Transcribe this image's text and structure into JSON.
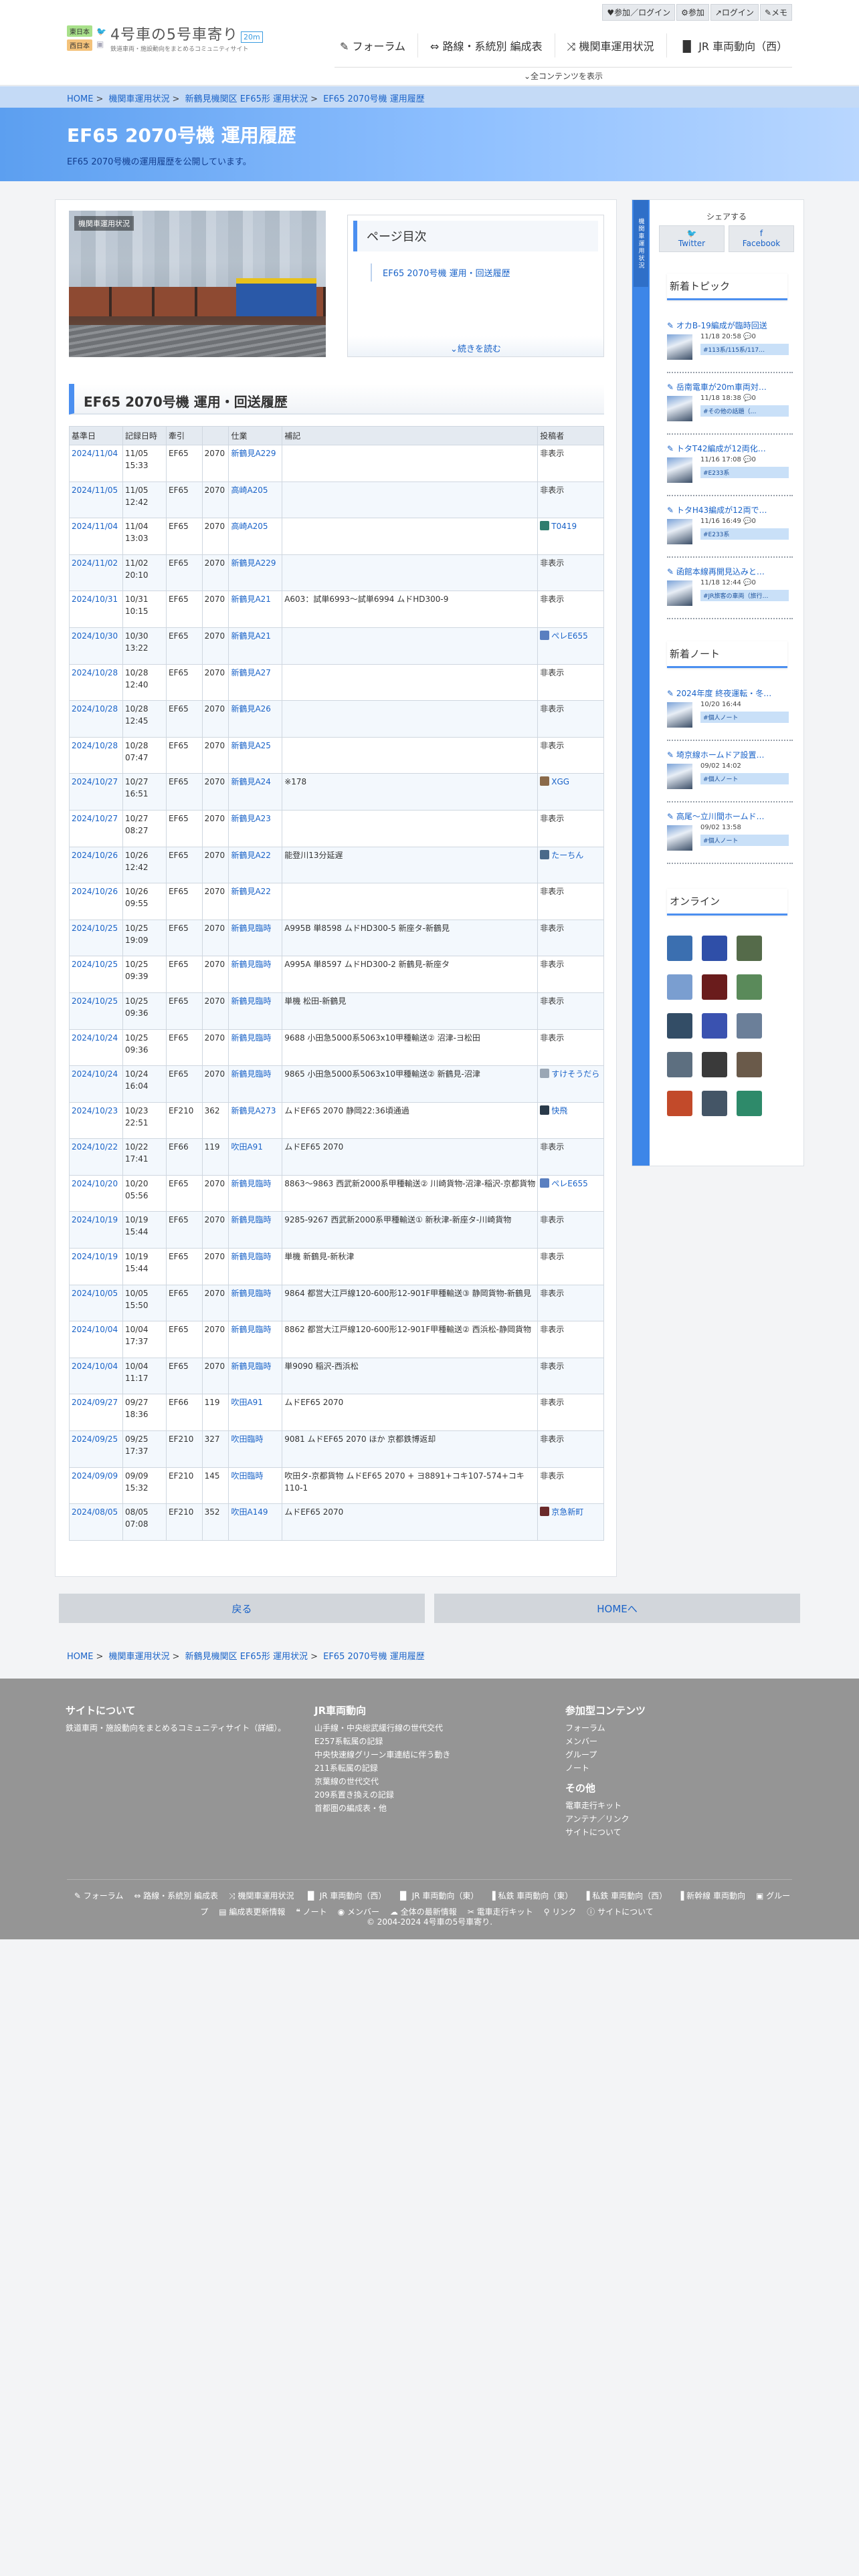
{
  "header": {
    "user_links": [
      "♥参加／ログイン",
      "⚙参加",
      "↗ログイン",
      "✎メモ"
    ],
    "tag_east": "東日本",
    "tag_west": "西日本",
    "site_title": "4号車の5号車寄り",
    "site_subtitle": "鉄道車両・施設動向をまとめるコミュニティサイト",
    "badge": "20m",
    "nav": [
      "✎ フォーラム",
      "⇔ 路線・系統別 編成表",
      "⤨ 機関車運用状況",
      "▐▌ JR 車両動向（西）"
    ],
    "all_content": "⌄全コンテンツを表示"
  },
  "breadcrumb": [
    "HOME",
    "機関車運用状況",
    "新鶴見機関区 EF65形 運用状況",
    "EF65 2070号機 運用履歴"
  ],
  "hero": {
    "title": "EF65 2070号機 運用履歴",
    "description": "EF65 2070号機の運用履歴を公開しています。"
  },
  "photo_label": "機関車運用状況",
  "toc": {
    "title": "ページ目次",
    "item": "EF65 2070号機 運用・回送履歴",
    "more": "⌄続きを読む"
  },
  "section_title": "EF65 2070号機 運用・回送履歴",
  "table": {
    "headers": [
      "基準日",
      "記録日時",
      "牽引",
      "",
      "仕業",
      "補記",
      "投稿者"
    ],
    "rows": [
      {
        "date": "2024/11/04",
        "obs": "11/05 15:33",
        "loco": "EF65",
        "num": "2070",
        "run": "新鶴見A229",
        "note": "",
        "poster": "非表示",
        "pcolor": ""
      },
      {
        "date": "2024/11/05",
        "obs": "11/05 12:42",
        "loco": "EF65",
        "num": "2070",
        "run": "高崎A205",
        "note": "",
        "poster": "非表示",
        "pcolor": ""
      },
      {
        "date": "2024/11/04",
        "obs": "11/04 13:03",
        "loco": "EF65",
        "num": "2070",
        "run": "高崎A205",
        "note": "",
        "poster": "T0419",
        "pcolor": "#2f7d6e"
      },
      {
        "date": "2024/11/02",
        "obs": "11/02 20:10",
        "loco": "EF65",
        "num": "2070",
        "run": "新鶴見A229",
        "note": "",
        "poster": "非表示",
        "pcolor": ""
      },
      {
        "date": "2024/10/31",
        "obs": "10/31 10:15",
        "loco": "EF65",
        "num": "2070",
        "run": "新鶴見A21",
        "note": "A603：試単6993〜試単6994 ムドHD300-9",
        "poster": "非表示",
        "pcolor": ""
      },
      {
        "date": "2024/10/30",
        "obs": "10/30 13:22",
        "loco": "EF65",
        "num": "2070",
        "run": "新鶴見A21",
        "note": "",
        "poster": "ぺレE655",
        "pcolor": "#5a7fc0"
      },
      {
        "date": "2024/10/28",
        "obs": "10/28 12:40",
        "loco": "EF65",
        "num": "2070",
        "run": "新鶴見A27",
        "note": "",
        "poster": "非表示",
        "pcolor": ""
      },
      {
        "date": "2024/10/28",
        "obs": "10/28 12:45",
        "loco": "EF65",
        "num": "2070",
        "run": "新鶴見A26",
        "note": "",
        "poster": "非表示",
        "pcolor": ""
      },
      {
        "date": "2024/10/28",
        "obs": "10/28 07:47",
        "loco": "EF65",
        "num": "2070",
        "run": "新鶴見A25",
        "note": "",
        "poster": "非表示",
        "pcolor": ""
      },
      {
        "date": "2024/10/27",
        "obs": "10/27 16:51",
        "loco": "EF65",
        "num": "2070",
        "run": "新鶴見A24",
        "note": "※178",
        "poster": "XGG",
        "pcolor": "#8a6a4a"
      },
      {
        "date": "2024/10/27",
        "obs": "10/27 08:27",
        "loco": "EF65",
        "num": "2070",
        "run": "新鶴見A23",
        "note": "",
        "poster": "非表示",
        "pcolor": ""
      },
      {
        "date": "2024/10/26",
        "obs": "10/26 12:42",
        "loco": "EF65",
        "num": "2070",
        "run": "新鶴見A22",
        "note": "能登川13分延遅",
        "poster": "たーちん",
        "pcolor": "#4a6a8a"
      },
      {
        "date": "2024/10/26",
        "obs": "10/26 09:55",
        "loco": "EF65",
        "num": "2070",
        "run": "新鶴見A22",
        "note": "",
        "poster": "非表示",
        "pcolor": ""
      },
      {
        "date": "2024/10/25",
        "obs": "10/25 19:09",
        "loco": "EF65",
        "num": "2070",
        "run": "新鶴見臨時",
        "note": "A995B 単8598 ムドHD300-5 新座タ-新鶴見",
        "poster": "非表示",
        "pcolor": ""
      },
      {
        "date": "2024/10/25",
        "obs": "10/25 09:39",
        "loco": "EF65",
        "num": "2070",
        "run": "新鶴見臨時",
        "note": "A995A 単8597 ムドHD300-2 新鶴見-新座タ",
        "poster": "非表示",
        "pcolor": ""
      },
      {
        "date": "2024/10/25",
        "obs": "10/25 09:36",
        "loco": "EF65",
        "num": "2070",
        "run": "新鶴見臨時",
        "note": "単機 松田-新鶴見",
        "poster": "非表示",
        "pcolor": ""
      },
      {
        "date": "2024/10/24",
        "obs": "10/25 09:36",
        "loco": "EF65",
        "num": "2070",
        "run": "新鶴見臨時",
        "note": "9688 小田急5000系5063x10甲種輸送② 沼津-ヨ松田",
        "poster": "非表示",
        "pcolor": ""
      },
      {
        "date": "2024/10/24",
        "obs": "10/24 16:04",
        "loco": "EF65",
        "num": "2070",
        "run": "新鶴見臨時",
        "note": "9865 小田急5000系5063x10甲種輸送② 新鶴見-沼津",
        "poster": "すけそうだら",
        "pcolor": "#9aa7b5"
      },
      {
        "date": "2024/10/23",
        "obs": "10/23 22:51",
        "loco": "EF210",
        "num": "362",
        "run": "新鶴見A273",
        "note": "ムドEF65 2070 静岡22:36頃通過",
        "poster": "快飛",
        "pcolor": "#2a3a4a"
      },
      {
        "date": "2024/10/22",
        "obs": "10/22 17:41",
        "loco": "EF66",
        "num": "119",
        "run": "吹田A91",
        "note": "ムドEF65 2070",
        "poster": "非表示",
        "pcolor": ""
      },
      {
        "date": "2024/10/20",
        "obs": "10/20 05:56",
        "loco": "EF65",
        "num": "2070",
        "run": "新鶴見臨時",
        "note": "8863〜9863 西武新2000系甲種輸送② 川崎貨物-沼津-稲沢-京都貨物",
        "poster": "ぺレE655",
        "pcolor": "#5a7fc0"
      },
      {
        "date": "2024/10/19",
        "obs": "10/19 15:44",
        "loco": "EF65",
        "num": "2070",
        "run": "新鶴見臨時",
        "note": "9285-9267 西武新2000系甲種輸送① 新秋津-新座タ-川崎貨物",
        "poster": "非表示",
        "pcolor": ""
      },
      {
        "date": "2024/10/19",
        "obs": "10/19 15:44",
        "loco": "EF65",
        "num": "2070",
        "run": "新鶴見臨時",
        "note": "単機 新鶴見-新秋津",
        "poster": "非表示",
        "pcolor": ""
      },
      {
        "date": "2024/10/05",
        "obs": "10/05 15:50",
        "loco": "EF65",
        "num": "2070",
        "run": "新鶴見臨時",
        "note": "9864 都営大江戸線120-600形12-901F甲種輸送③ 静岡貨物-新鶴見",
        "poster": "非表示",
        "pcolor": ""
      },
      {
        "date": "2024/10/04",
        "obs": "10/04 17:37",
        "loco": "EF65",
        "num": "2070",
        "run": "新鶴見臨時",
        "note": "8862 都営大江戸線120-600形12-901F甲種輸送② 西浜松-静岡貨物",
        "poster": "非表示",
        "pcolor": ""
      },
      {
        "date": "2024/10/04",
        "obs": "10/04 11:17",
        "loco": "EF65",
        "num": "2070",
        "run": "新鶴見臨時",
        "note": "単9090 稲沢-西浜松",
        "poster": "非表示",
        "pcolor": ""
      },
      {
        "date": "2024/09/27",
        "obs": "09/27 18:36",
        "loco": "EF66",
        "num": "119",
        "run": "吹田A91",
        "note": "ムドEF65 2070",
        "poster": "非表示",
        "pcolor": ""
      },
      {
        "date": "2024/09/25",
        "obs": "09/25 17:37",
        "loco": "EF210",
        "num": "327",
        "run": "吹田臨時",
        "note": "9081 ムドEF65 2070 ほか 京都鉄博返却",
        "poster": "非表示",
        "pcolor": ""
      },
      {
        "date": "2024/09/09",
        "obs": "09/09 15:32",
        "loco": "EF210",
        "num": "145",
        "run": "吹田臨時",
        "note": "吹田タ-京都貨物 ムドEF65 2070 + ヨ8891+コキ107-574+コキ110-1",
        "poster": "非表示",
        "pcolor": ""
      },
      {
        "date": "2024/08/05",
        "obs": "08/05 07:08",
        "loco": "EF210",
        "num": "352",
        "run": "吹田A149",
        "note": "ムドEF65 2070",
        "poster": "京急新町",
        "pcolor": "#6a2a2a"
      }
    ]
  },
  "sidebar": {
    "strip_caption": "機関車運用状況",
    "share_title": "シェアする",
    "share_twitter": "Twitter",
    "share_facebook": "Facebook",
    "new_topics_title": "新着トピック",
    "topics": [
      {
        "title": "オカB-19編成が臨時回送",
        "meta": "11/18 20:58 💬0",
        "tag": "#113系/115系/117…"
      },
      {
        "title": "岳南電車が20m車両対…",
        "meta": "11/18 18:38 💬0",
        "tag": "#その他の話題（…"
      },
      {
        "title": "トタT42編成が12両化…",
        "meta": "11/16 17:08 💬0",
        "tag": "#E233系"
      },
      {
        "title": "トタH43編成が12両で…",
        "meta": "11/16 16:49 💬0",
        "tag": "#E233系"
      },
      {
        "title": "函館本線再開見込みと…",
        "meta": "11/18 12:44 💬0",
        "tag": "#JR旅客の車両（旅行…"
      }
    ],
    "new_notes_title": "新着ノート",
    "notes": [
      {
        "title": "2024年度 終夜運転・冬…",
        "meta": "10/20 16:44",
        "tag": "#個人ノート"
      },
      {
        "title": "埼京線ホームドア設置…",
        "meta": "09/02 14:02",
        "tag": "#個人ノート"
      },
      {
        "title": "高尾〜立川間ホームド…",
        "meta": "09/02 13:58",
        "tag": "#個人ノート"
      }
    ],
    "online_title": "オンライン",
    "online_avatar_colors": [
      "#3b6fb0",
      "#2f4fa8",
      "#556b4a",
      "#7a9ed0",
      "#6a1c1c",
      "#5a8a5a",
      "#334d66",
      "#3a52b0",
      "#6b7f99",
      "#5d6f80",
      "#3a3a3a",
      "#6a5a4a",
      "#c24a2a",
      "#445566",
      "#2e8a6a"
    ]
  },
  "buttons": {
    "back": "戻る",
    "home": "HOMEへ"
  },
  "footer": {
    "about_title": "サイトについて",
    "about_text": "鉄道車両・施設動向をまとめるコミュニティサイト（詳細）。",
    "jr_title": "JR車両動向",
    "jr_links": [
      "山手線・中央総武緩行線の世代交代",
      "E257系転属の記録",
      "中央快速線グリーン車連結に伴う動き",
      "211系転属の記録",
      "京葉線の世代交代",
      "209系置き換えの記録",
      "首都圏の編成表・他"
    ],
    "join_title": "参加型コンテンツ",
    "join_links": [
      "フォーラム",
      "メンバー",
      "グループ",
      "ノート"
    ],
    "other_title": "その他",
    "other_links": [
      "電車走行キット",
      "アンテナ／リンク",
      "サイトについて"
    ],
    "bottom_links": [
      "✎ フォーラム",
      "⇔ 路線・系統別 編成表",
      "⤨ 機関車運用状況",
      "▐▌ JR 車両動向（西）",
      "▐▌ JR 車両動向（東）",
      "▐ 私鉄 車両動向（東）",
      "▐ 私鉄 車両動向（西）",
      "▐ 新幹線 車両動向",
      "▣ グループ",
      "▤ 編成表更新情報",
      "❝ ノート",
      "◉ メンバー",
      "☁ 全体の最新情報",
      "✂ 電車走行キット",
      "⚲ リンク",
      "ⓘ サイトについて"
    ],
    "copyright": "© 2004-2024 4号車の5号車寄り."
  }
}
